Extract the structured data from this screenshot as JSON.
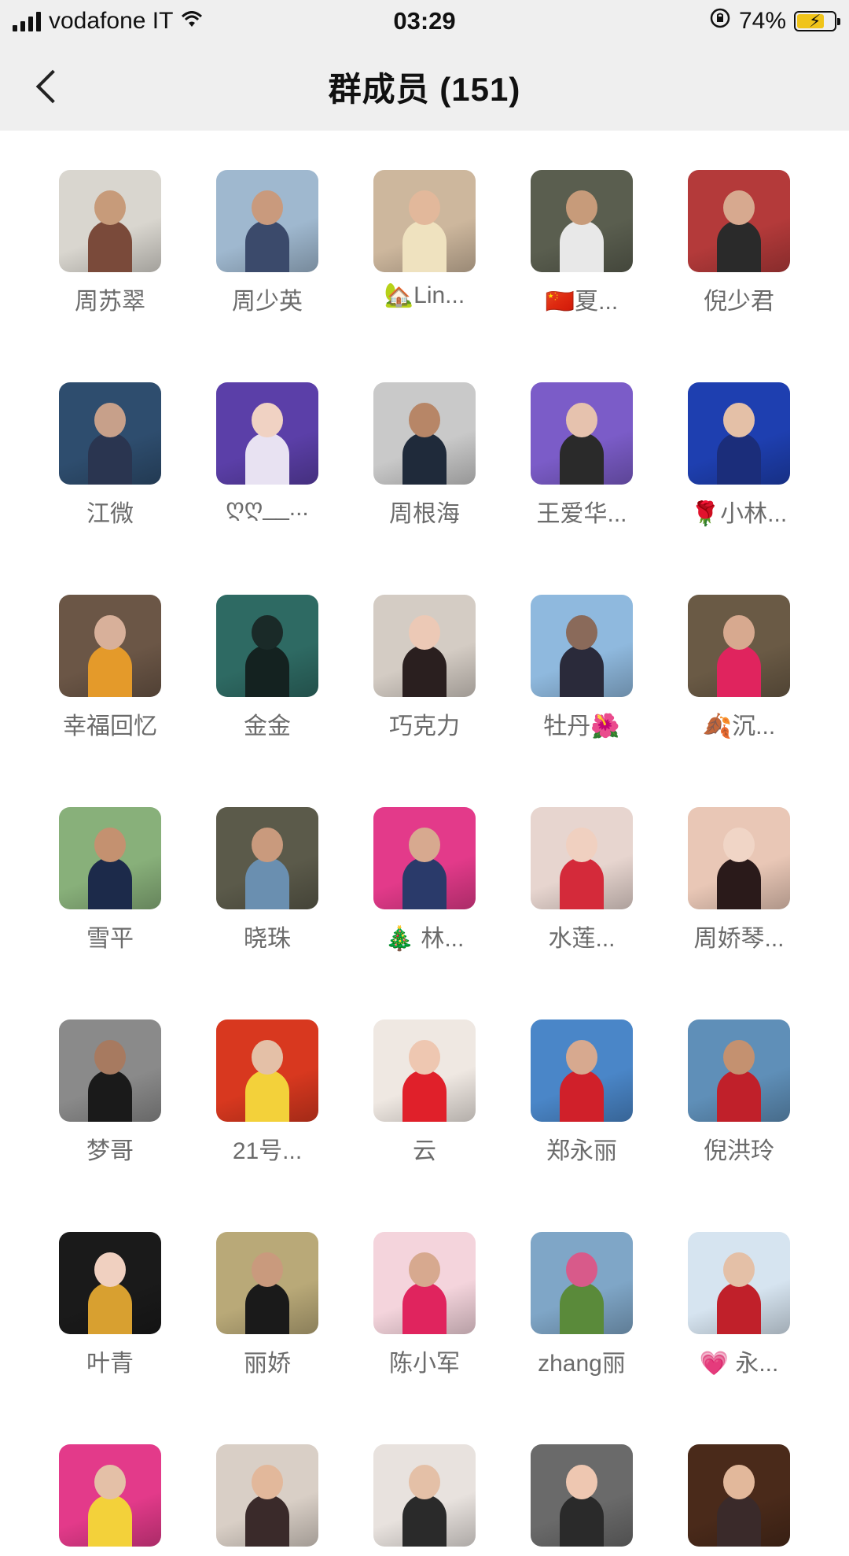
{
  "status_bar": {
    "carrier": "vodafone IT",
    "time": "03:29",
    "battery": "74%",
    "battery_level": 0.74
  },
  "nav": {
    "title": "群成员 (151)",
    "back_icon": "chevron-left-icon"
  },
  "members": [
    {
      "name": "周苏翠",
      "bg": "#d9d6cf",
      "skin": "#c79b7a",
      "cloth": "#7a4a3a"
    },
    {
      "name": "周少英",
      "bg": "#9fb8cf",
      "skin": "#c99a7d",
      "cloth": "#3b4a6b"
    },
    {
      "name": "🏡Lin...",
      "bg": "#cdb79d",
      "skin": "#e2b89b",
      "cloth": "#efe2bf"
    },
    {
      "name": "🇨🇳夏...",
      "bg": "#5a5e4f",
      "skin": "#c79b7a",
      "cloth": "#e8e8e8"
    },
    {
      "name": "倪少君",
      "bg": "#b43a3a",
      "skin": "#d7a98f",
      "cloth": "#2a2a2a"
    },
    {
      "name": "江微",
      "bg": "#2e4d6e",
      "skin": "#c7a08a",
      "cloth": "#2a3550"
    },
    {
      "name": "ღღ__...",
      "bg": "#5b3fa8",
      "skin": "#f0d2c3",
      "cloth": "#e8e2f2"
    },
    {
      "name": "周根海",
      "bg": "#c9c9c9",
      "skin": "#b78667",
      "cloth": "#1f2a3a"
    },
    {
      "name": "王爱华...",
      "bg": "#7b5cc8",
      "skin": "#e6c2ae",
      "cloth": "#2a2a2a"
    },
    {
      "name": "🌹小林...",
      "bg": "#1e3fb0",
      "skin": "#e4c0a7",
      "cloth": "#1b2d7a"
    },
    {
      "name": "幸福回忆",
      "bg": "#6b5646",
      "skin": "#d8b09a",
      "cloth": "#e49a2a"
    },
    {
      "name": "金金",
      "bg": "#2e6a63",
      "skin": "#1a2a28",
      "cloth": "#142220"
    },
    {
      "name": "巧克力",
      "bg": "#d4ccc4",
      "skin": "#ecc9b6",
      "cloth": "#2a1f1f"
    },
    {
      "name": "牡丹🌺",
      "bg": "#8fb9de",
      "skin": "#8a6a5a",
      "cloth": "#2a2a3a"
    },
    {
      "name": "🍂沉...",
      "bg": "#6a5a45",
      "skin": "#d7a98f",
      "cloth": "#e0245e"
    },
    {
      "name": "雪平",
      "bg": "#88b07a",
      "skin": "#c49170",
      "cloth": "#1c2a4a"
    },
    {
      "name": "晓珠",
      "bg": "#5b5a4a",
      "skin": "#c99a7d",
      "cloth": "#6a8fb0"
    },
    {
      "name": "🎄 林...",
      "bg": "#e33a8a",
      "skin": "#d7a98f",
      "cloth": "#2a3a6a"
    },
    {
      "name": "水莲...",
      "bg": "#e7d5cf",
      "skin": "#f0d0c0",
      "cloth": "#d42a3a"
    },
    {
      "name": "周娇琴...",
      "bg": "#e9c7b6",
      "skin": "#f0d5c6",
      "cloth": "#2a1a1a"
    },
    {
      "name": "梦哥",
      "bg": "#8a8a8a",
      "skin": "#a77a60",
      "cloth": "#1a1a1a"
    },
    {
      "name": "21号...",
      "bg": "#d8381f",
      "skin": "#e4c0a7",
      "cloth": "#f3d13a"
    },
    {
      "name": "云",
      "bg": "#efe8e2",
      "skin": "#eec7b1",
      "cloth": "#e0202a"
    },
    {
      "name": "郑永丽",
      "bg": "#4a86c8",
      "skin": "#d7a98f",
      "cloth": "#d0202a"
    },
    {
      "name": "倪洪玲",
      "bg": "#5f8fb8",
      "skin": "#c49170",
      "cloth": "#c0202a"
    },
    {
      "name": "叶青",
      "bg": "#1a1a1a",
      "skin": "#f0d0c0",
      "cloth": "#d8a030"
    },
    {
      "name": "丽娇",
      "bg": "#b9a978",
      "skin": "#c99a7d",
      "cloth": "#1a1a1a"
    },
    {
      "name": "陈小军",
      "bg": "#f4d4dc",
      "skin": "#d7a98f",
      "cloth": "#e0245e"
    },
    {
      "name": "zhang丽",
      "bg": "#7fa6c7",
      "skin": "#d85a8a",
      "cloth": "#5a8a3a"
    },
    {
      "name": "💗 永...",
      "bg": "#d6e4f0",
      "skin": "#e4c0a7",
      "cloth": "#c0202a"
    },
    {
      "name": "",
      "bg": "#e33a8a",
      "skin": "#e4c0a7",
      "cloth": "#f3d13a"
    },
    {
      "name": "",
      "bg": "#d9cfc6",
      "skin": "#e2b89b",
      "cloth": "#3a2a2a"
    },
    {
      "name": "",
      "bg": "#e8e2de",
      "skin": "#e4c0a7",
      "cloth": "#2a2a2a"
    },
    {
      "name": "",
      "bg": "#6a6a6a",
      "skin": "#eec7b1",
      "cloth": "#2a2a2a"
    },
    {
      "name": "",
      "bg": "#4a2a1a",
      "skin": "#e2b89b",
      "cloth": "#3a2a2a"
    }
  ]
}
